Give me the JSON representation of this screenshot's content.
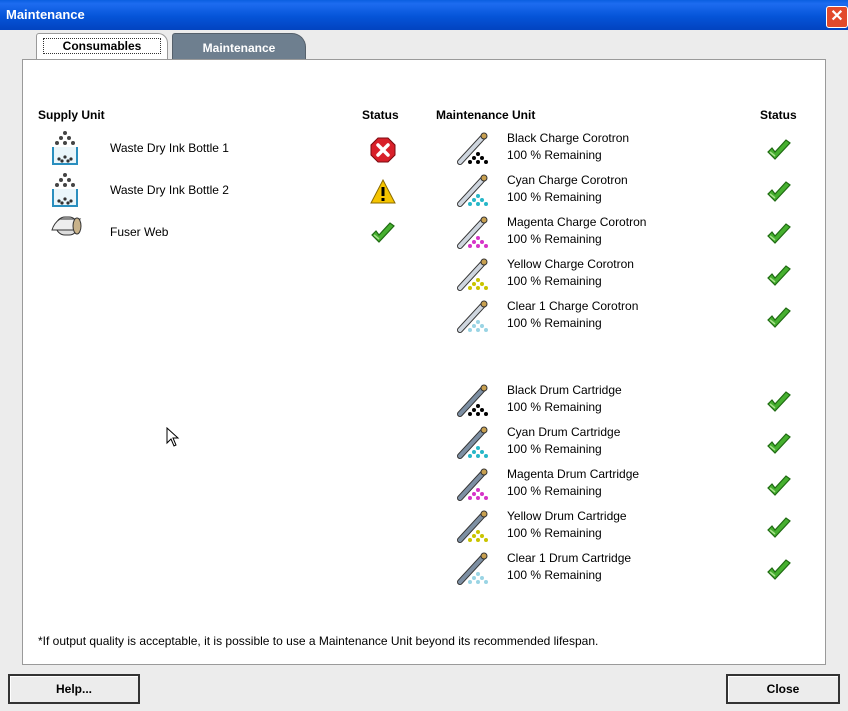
{
  "window": {
    "title": "Maintenance",
    "close_glyph": "✕"
  },
  "tabs": [
    {
      "label": "Consumables",
      "active": true
    },
    {
      "label": "Maintenance",
      "active": false
    }
  ],
  "supply": {
    "header": "Supply Unit",
    "status_header": "Status",
    "items": [
      {
        "name": "Waste Dry Ink Bottle 1",
        "status": "error"
      },
      {
        "name": "Waste Dry Ink Bottle 2",
        "status": "warning"
      },
      {
        "name": "Fuser Web",
        "status": "ok"
      }
    ]
  },
  "maintenance": {
    "header": "Maintenance Unit",
    "status_header": "Status",
    "items": [
      {
        "name": "Black Charge Corotron",
        "remaining": "100 % Remaining",
        "color": "#000000",
        "status": "ok"
      },
      {
        "name": "Cyan Charge Corotron",
        "remaining": "100 % Remaining",
        "color": "#27b7c8",
        "status": "ok"
      },
      {
        "name": "Magenta Charge Corotron",
        "remaining": "100 % Remaining",
        "color": "#d634c8",
        "status": "ok"
      },
      {
        "name": "Yellow Charge Corotron",
        "remaining": "100 % Remaining",
        "color": "#c9c400",
        "status": "ok"
      },
      {
        "name": "Clear 1 Charge Corotron",
        "remaining": "100 % Remaining",
        "color": "#9ad4e4",
        "status": "ok"
      },
      {
        "name": "Black Drum Cartridge",
        "remaining": "100 % Remaining",
        "color": "#000000",
        "status": "ok"
      },
      {
        "name": "Cyan Drum Cartridge",
        "remaining": "100 % Remaining",
        "color": "#27b7c8",
        "status": "ok"
      },
      {
        "name": "Magenta Drum Cartridge",
        "remaining": "100 % Remaining",
        "color": "#d634c8",
        "status": "ok"
      },
      {
        "name": "Yellow Drum Cartridge",
        "remaining": "100 % Remaining",
        "color": "#c9c400",
        "status": "ok"
      },
      {
        "name": "Clear 1 Drum Cartridge",
        "remaining": "100 % Remaining",
        "color": "#9ad4e4",
        "status": "ok"
      }
    ]
  },
  "note": "*If output quality is acceptable, it is possible to use a Maintenance Unit beyond its recommended lifespan.",
  "buttons": {
    "help": "Help...",
    "close": "Close"
  }
}
